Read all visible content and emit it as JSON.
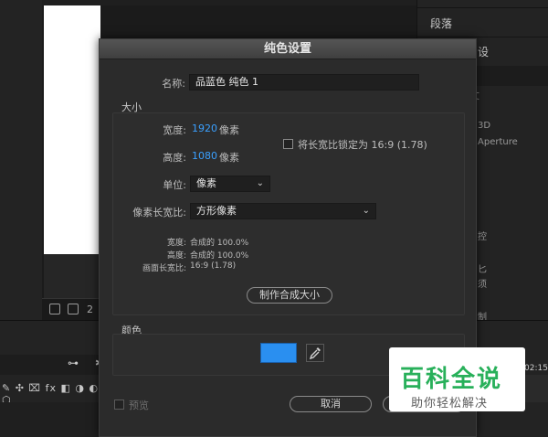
{
  "background": {
    "right_panel": {
      "paragraph_label": "段落",
      "set_label": "设",
      "small_aperture": "Aperture",
      "small_3d": "3D",
      "frag_1": "丈",
      "frag_2": "控",
      "frag_3": "匕",
      "frag_4": "须",
      "frag_5": "制"
    },
    "viewer": {
      "zoom_text": "2"
    },
    "timeline": {
      "time_text": "02:15",
      "tools_text": "✎ ✣ ⌧ fx ◧ ◑ ◐ ⬡"
    }
  },
  "dialog": {
    "title": "纯色设置",
    "name_label": "名称:",
    "name_value": "品蓝色 纯色 1",
    "size_group_title": "大小",
    "width_label": "宽度:",
    "width_value": "1920",
    "width_unit": "像素",
    "height_label": "高度:",
    "height_value": "1080",
    "height_unit": "像素",
    "lock_aspect_label": "将长宽比锁定为 16:9 (1.78)",
    "unit_label": "单位:",
    "unit_value": "像素",
    "pixel_aspect_label": "像素长宽比:",
    "pixel_aspect_value": "方形像素",
    "info": {
      "width_label": "宽度:",
      "width_value": "合成的 100.0%",
      "height_label": "高度:",
      "height_value": "合成的 100.0%",
      "frame_aspect_label": "画面长宽比:",
      "frame_aspect_value": "16:9 (1.78)"
    },
    "make_comp_size_button": "制作合成大小",
    "color_group_title": "颜色",
    "swatch_color": "#2a8ff0",
    "preview_label": "预览",
    "cancel_button": "取消"
  },
  "watermark": {
    "main": "百科全说",
    "sub": "助你轻松解决"
  },
  "colors": {
    "accent": "#3aa0ff",
    "swatch": "#2a8ff0",
    "watermark_green": "#28b05a"
  }
}
